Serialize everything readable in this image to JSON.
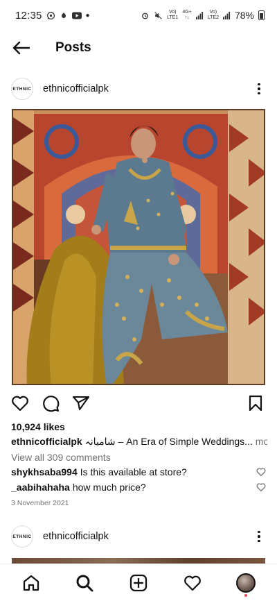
{
  "status_bar": {
    "time": "12:35",
    "battery_percent": "78%",
    "net1_top": "Vo)",
    "net1_bottom": "LTE1",
    "net2_top": "4G+",
    "net3_top": "Vo)",
    "net3_bottom": "LTE2"
  },
  "header": {
    "title": "Posts"
  },
  "post": {
    "avatar_text": "ETHNIC",
    "username": "ethnicofficialpk",
    "likes": "10,924 likes",
    "caption_user": "ethnicofficialpk",
    "caption_text": "شامیانہ – An Era of Simple Weddings...",
    "caption_more": "more",
    "view_comments": "View all 309 comments",
    "comments": [
      {
        "user": "shykhsaba994",
        "text": "Is this available at store?"
      },
      {
        "user": "_aabihahaha",
        "text": "how much price?"
      }
    ],
    "date": "3 November 2021"
  },
  "post2": {
    "avatar_text": "ETHNIC",
    "username": "ethnicofficialpk"
  },
  "icons": {
    "back": "arrow-left-icon",
    "like": "heart-icon",
    "comment": "comment-icon",
    "share": "paper-plane-icon",
    "save": "bookmark-icon",
    "home": "home-icon",
    "search": "search-icon",
    "create": "plus-square-icon",
    "activity": "heart-icon",
    "profile": "avatar"
  },
  "colors": {
    "muted_text": "#737373",
    "notification": "#ed4956"
  }
}
